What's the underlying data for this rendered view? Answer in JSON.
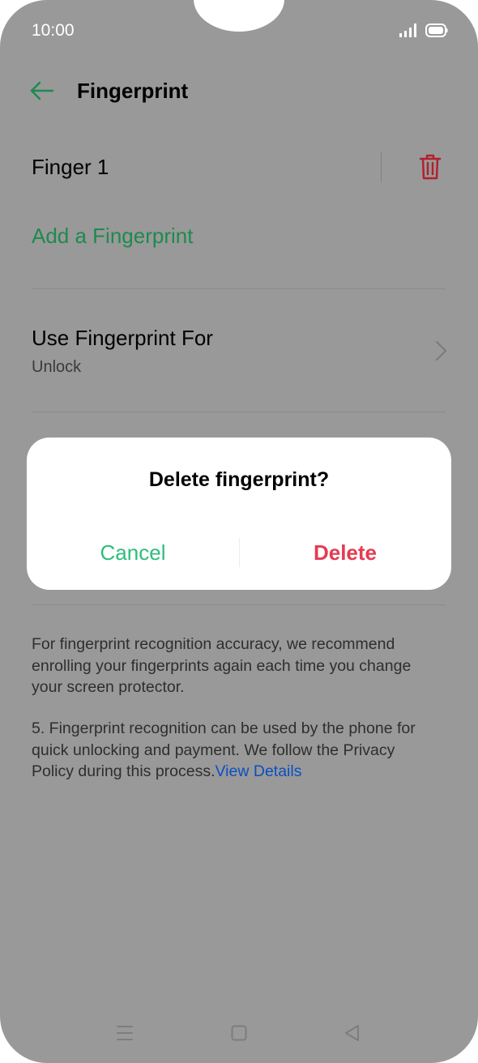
{
  "status_bar": {
    "time": "10:00"
  },
  "header": {
    "title": "Fingerprint"
  },
  "fingerprint_list": {
    "finger_name": "Finger 1"
  },
  "add_fingerprint": {
    "label": "Add a Fingerprint"
  },
  "use_fingerprint_for": {
    "label": "Use Fingerprint For",
    "value": "Unlock"
  },
  "dialog": {
    "title": "Delete fingerprint?",
    "cancel_label": "Cancel",
    "delete_label": "Delete"
  },
  "info": {
    "paragraph1": "For fingerprint recognition accuracy, we recommend enrolling your fingerprints again each time you change your screen protector.",
    "paragraph2": "5. Fingerprint recognition can be used by the phone for quick unlocking and payment. We follow the Privacy Policy during this process.",
    "view_details_link": "View Details"
  },
  "icons": {
    "back": "back-arrow-icon",
    "trash": "trash-icon",
    "chevron": "chevron-right-icon",
    "nav_menu": "menu-icon",
    "nav_home": "home-icon",
    "nav_back": "back-triangle-icon"
  },
  "colors": {
    "accent_green": "#1e8a4e",
    "cancel_green": "#2ebd7a",
    "delete_red": "#e33c52",
    "trash_red": "#b3202e",
    "link_blue": "#0a4fc2"
  }
}
